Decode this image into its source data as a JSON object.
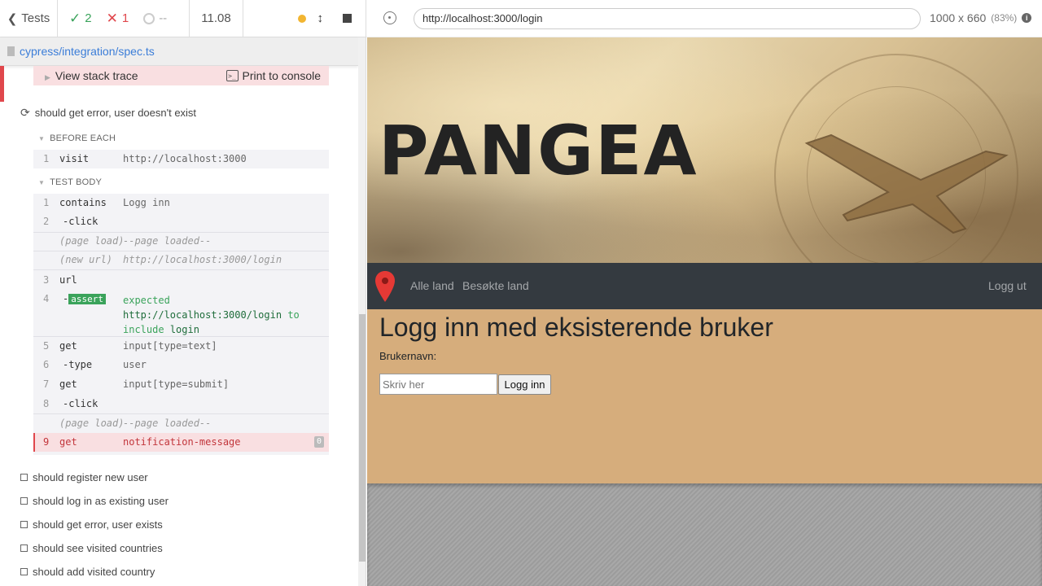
{
  "reporter": {
    "tests_label": "Tests",
    "passed": "2",
    "failed": "1",
    "pending": "--",
    "duration": "11.08",
    "spec_path": "cypress/integration/spec.ts"
  },
  "error_box": {
    "stack_trace_label": "View stack trace",
    "console_label": "Print to console",
    "console_icon": ">_"
  },
  "current_test": {
    "title": "should get error, user doesn't exist",
    "before_each_label": "BEFORE EACH",
    "test_body_label": "TEST BODY"
  },
  "before_each_commands": [
    {
      "num": "1",
      "name": "visit",
      "message": "http://localhost:3000"
    }
  ],
  "test_body_commands": [
    {
      "num": "1",
      "name": "contains",
      "message": "Logg inn"
    },
    {
      "num": "2",
      "name": "-click",
      "message": ""
    },
    {
      "num": "",
      "name": "(page load)",
      "message": "--page loaded--"
    },
    {
      "num": "",
      "name": "(new url)",
      "message": "http://localhost:3000/login"
    },
    {
      "num": "3",
      "name": "url",
      "message": ""
    },
    {
      "num": "4",
      "name": "-",
      "badge": "assert",
      "message_parts": [
        "expected",
        "http://localhost:3000/login",
        "to",
        "include",
        "login"
      ]
    },
    {
      "num": "5",
      "name": "get",
      "message": "input[type=text]"
    },
    {
      "num": "6",
      "name": "-type",
      "message": "user"
    },
    {
      "num": "7",
      "name": "get",
      "message": "input[type=submit]"
    },
    {
      "num": "8",
      "name": "-click",
      "message": ""
    },
    {
      "num": "",
      "name": "(page load)",
      "message": "--page loaded--"
    },
    {
      "num": "9",
      "name": "get",
      "message": "notification-message",
      "count": "0"
    }
  ],
  "other_tests": [
    "should register new user",
    "should log in as existing user",
    "should get error, user exists",
    "should see visited countries",
    "should add visited country"
  ],
  "aut": {
    "url": "http://localhost:3000/login",
    "viewport": "1000 x 660",
    "scale": "(83%)",
    "info_icon": "i"
  },
  "app": {
    "banner_title": "PANGEA",
    "nav_links": [
      "Alle land",
      "Besøkte land"
    ],
    "logout_label": "Logg ut",
    "heading": "Logg inn med eksisterende bruker",
    "username_label": "Brukernavn:",
    "username_placeholder": "Skriv her",
    "login_button": "Logg inn"
  },
  "colors": {
    "pass": "#3aa35b",
    "fail": "#e0474c",
    "navbar": "#343a40",
    "content_bg": "#d6ad7c"
  }
}
